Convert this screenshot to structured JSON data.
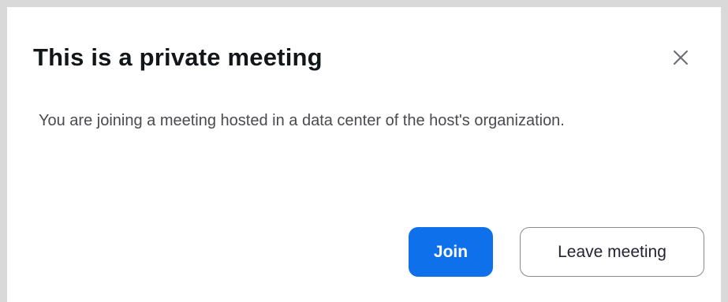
{
  "dialog": {
    "title": "This is a private meeting",
    "message": "You are joining a meeting hosted in a data center of the host's organization.",
    "close_icon": "close-icon",
    "buttons": {
      "join_label": "Join",
      "leave_label": "Leave meeting"
    }
  },
  "colors": {
    "primary": "#0e71eb",
    "title_text": "#131619",
    "body_text": "#4a4a4f",
    "backdrop": "#d9d9d9"
  }
}
